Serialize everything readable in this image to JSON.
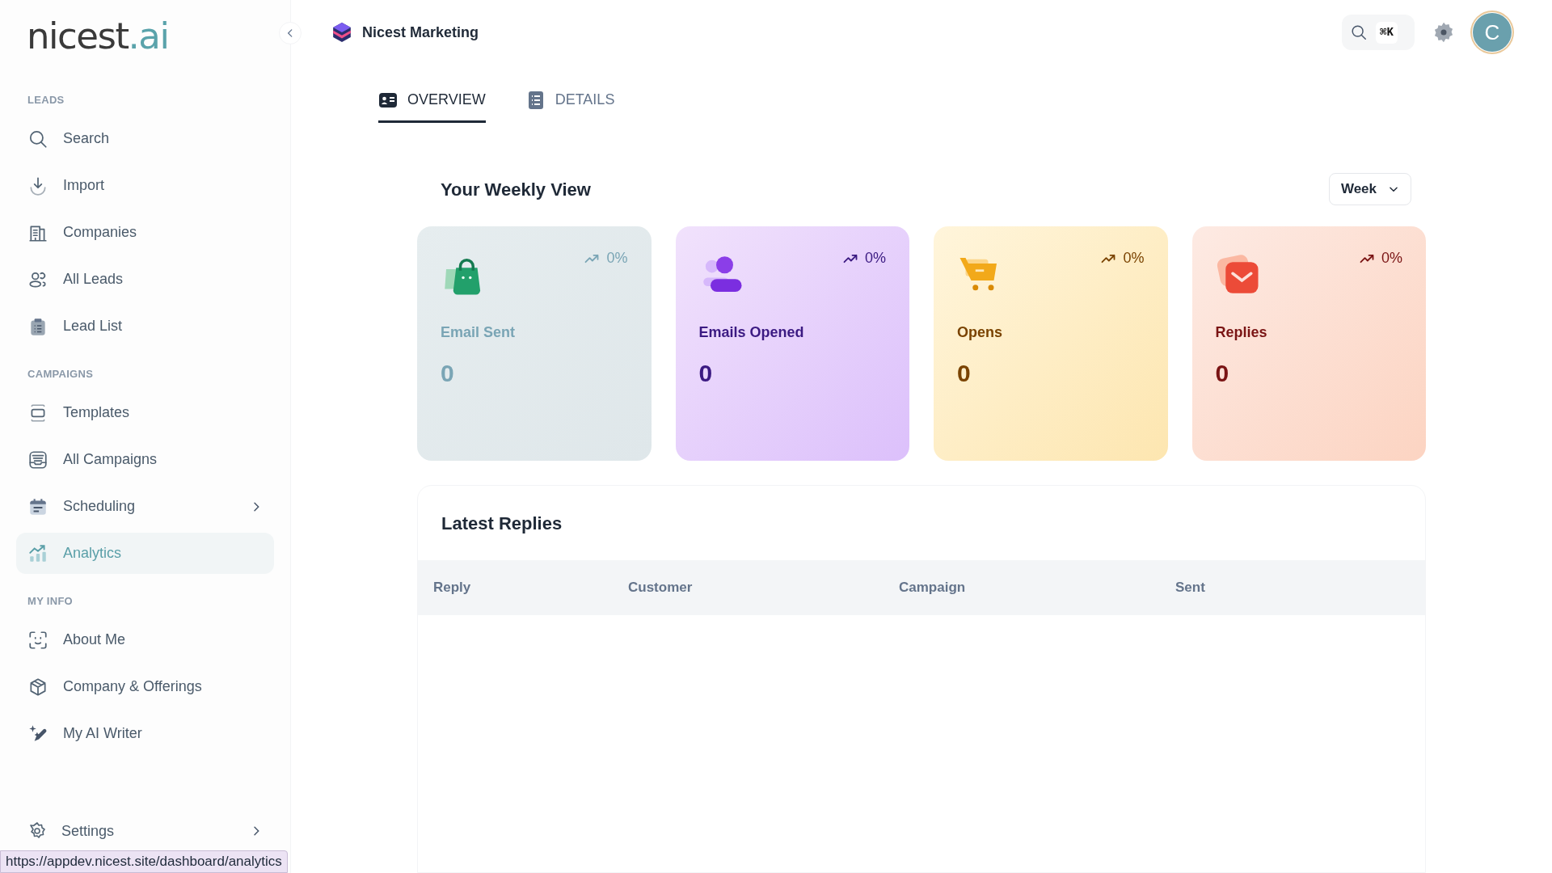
{
  "logo": {
    "text": "nicest",
    "accent": ".ai"
  },
  "sidebar": {
    "sections": [
      {
        "title": "LEADS",
        "items": [
          {
            "label": "Search",
            "selected": false,
            "expandable": false
          },
          {
            "label": "Import",
            "selected": false,
            "expandable": false
          },
          {
            "label": "Companies",
            "selected": false,
            "expandable": false
          },
          {
            "label": "All Leads",
            "selected": false,
            "expandable": false
          },
          {
            "label": "Lead List",
            "selected": false,
            "expandable": false
          }
        ]
      },
      {
        "title": "CAMPAIGNS",
        "items": [
          {
            "label": "Templates",
            "selected": false,
            "expandable": false
          },
          {
            "label": "All Campaigns",
            "selected": false,
            "expandable": false
          },
          {
            "label": "Scheduling",
            "selected": false,
            "expandable": true
          },
          {
            "label": "Analytics",
            "selected": true,
            "expandable": false
          }
        ]
      },
      {
        "title": "MY INFO",
        "items": [
          {
            "label": "About Me",
            "selected": false,
            "expandable": false
          },
          {
            "label": "Company & Offerings",
            "selected": false,
            "expandable": false
          },
          {
            "label": "My AI Writer",
            "selected": false,
            "expandable": false
          }
        ]
      }
    ],
    "footer_item": {
      "label": "Settings",
      "expandable": true
    }
  },
  "header": {
    "workspace": "Nicest Marketing",
    "shortcut": "⌘K",
    "avatar": "C"
  },
  "tabs": [
    {
      "label": "OVERVIEW",
      "selected": true
    },
    {
      "label": "DETAILS",
      "selected": false
    }
  ],
  "weekly": {
    "title": "Your Weekly View",
    "period": "Week",
    "cards": [
      {
        "kind": "sent",
        "label": "Email Sent",
        "value": "0",
        "change": "0%",
        "color": "#7aa5b5"
      },
      {
        "kind": "opened",
        "label": "Emails Opened",
        "value": "0",
        "change": "0%",
        "color": "#3b1a82"
      },
      {
        "kind": "opens",
        "label": "Opens",
        "value": "0",
        "change": "0%",
        "color": "#7a4300"
      },
      {
        "kind": "replies",
        "label": "Replies",
        "value": "0",
        "change": "0%",
        "color": "#7a1414"
      }
    ]
  },
  "replies_table": {
    "title": "Latest Replies",
    "columns": [
      "Reply",
      "Customer",
      "Campaign",
      "Sent"
    ]
  },
  "status_url": "https://appdev.nicest.site/dashboard/analytics"
}
